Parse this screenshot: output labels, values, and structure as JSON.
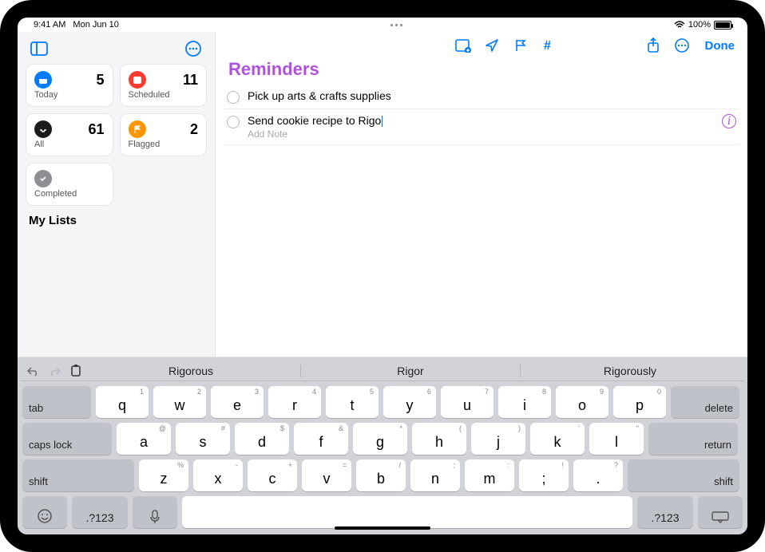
{
  "status": {
    "time": "9:41 AM",
    "date": "Mon Jun 10",
    "battery": "100%"
  },
  "sidebar": {
    "cards": [
      {
        "label": "Today",
        "count": "5",
        "icon_bg": "#007aff"
      },
      {
        "label": "Scheduled",
        "count": "11",
        "icon_bg": "#ff3b30"
      },
      {
        "label": "All",
        "count": "61",
        "icon_bg": "#1c1c1e"
      },
      {
        "label": "Flagged",
        "count": "2",
        "icon_bg": "#ff9500"
      },
      {
        "label": "Completed",
        "count": "",
        "icon_bg": "#8e8e93"
      }
    ],
    "section_header": "My Lists"
  },
  "main": {
    "title": "Reminders",
    "done_label": "Done",
    "add_note_placeholder": "Add Note",
    "items": [
      {
        "title": "Pick up arts & crafts supplies",
        "editing": false
      },
      {
        "title": "Send cookie recipe to Rigo",
        "editing": true
      }
    ]
  },
  "keyboard": {
    "suggestions": [
      "Rigorous",
      "Rigor",
      "Rigorously"
    ],
    "row1": [
      {
        "main": "q",
        "sub": "1"
      },
      {
        "main": "w",
        "sub": "2"
      },
      {
        "main": "e",
        "sub": "3"
      },
      {
        "main": "r",
        "sub": "4"
      },
      {
        "main": "t",
        "sub": "5"
      },
      {
        "main": "y",
        "sub": "6"
      },
      {
        "main": "u",
        "sub": "7"
      },
      {
        "main": "i",
        "sub": "8"
      },
      {
        "main": "o",
        "sub": "9"
      },
      {
        "main": "p",
        "sub": "0"
      }
    ],
    "row2": [
      {
        "main": "a",
        "sub": "@"
      },
      {
        "main": "s",
        "sub": "#"
      },
      {
        "main": "d",
        "sub": "$"
      },
      {
        "main": "f",
        "sub": "&"
      },
      {
        "main": "g",
        "sub": "*"
      },
      {
        "main": "h",
        "sub": "("
      },
      {
        "main": "j",
        "sub": ")"
      },
      {
        "main": "k",
        "sub": "'"
      },
      {
        "main": "l",
        "sub": "\""
      }
    ],
    "row3": [
      {
        "main": "z",
        "sub": "%"
      },
      {
        "main": "x",
        "sub": "-"
      },
      {
        "main": "c",
        "sub": "+"
      },
      {
        "main": "v",
        "sub": "="
      },
      {
        "main": "b",
        "sub": "/"
      },
      {
        "main": "n",
        "sub": ";"
      },
      {
        "main": "m",
        "sub": ":"
      },
      {
        "main": ";",
        "sub": "!"
      },
      {
        "main": ".",
        "sub": "?"
      }
    ],
    "labels": {
      "tab": "tab",
      "delete": "delete",
      "caps": "caps lock",
      "return": "return",
      "shift": "shift",
      "numsym": ".?123"
    }
  }
}
